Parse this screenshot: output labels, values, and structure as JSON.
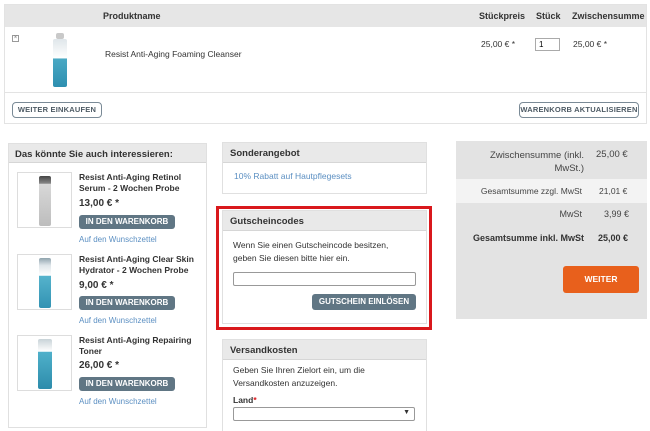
{
  "cart": {
    "headers": {
      "product": "Produktname",
      "unit_price": "Stückpreis",
      "qty": "Stück",
      "subtotal": "Zwischensumme"
    },
    "item": {
      "name": "Resist Anti-Aging Foaming Cleanser",
      "unit_price": "25,00 € *",
      "qty": "1",
      "subtotal": "25,00 € *",
      "remove_icon": "close-icon"
    },
    "continue_label": "WEITER EINKAUFEN",
    "update_label": "WARENKORB AKTUALISIEREN"
  },
  "suggestions": {
    "title": "Das könnte Sie auch interessieren:",
    "items": [
      {
        "name": "Resist Anti-Aging Retinol Serum - 2 Wochen Probe",
        "price": "13,00 € *",
        "cart_label": "IN DEN WARENKORB",
        "wishlist": "Auf den Wunschzettel"
      },
      {
        "name": "Resist Anti-Aging Clear Skin Hydrator - 2 Wochen Probe",
        "price": "9,00 € *",
        "cart_label": "IN DEN WARENKORB",
        "wishlist": "Auf den Wunschzettel"
      },
      {
        "name": "Resist Anti-Aging Repairing Toner",
        "price": "26,00 € *",
        "cart_label": "IN DEN WARENKORB",
        "wishlist": "Auf den Wunschzettel"
      }
    ]
  },
  "special": {
    "title": "Sonderangebot",
    "link": "10% Rabatt auf Hautpflegesets"
  },
  "coupon": {
    "title": "Gutscheincodes",
    "text": "Wenn Sie einen Gutscheincode besitzen, geben Sie diesen bitte hier ein.",
    "input_value": "",
    "button": "GUTSCHEIN EINLÖSEN",
    "highlight_color": "#d9181c"
  },
  "shipping": {
    "title": "Versandkosten",
    "text": "Geben Sie Ihren Zielort ein, um die Versandkosten anzuzeigen.",
    "country_label": "Land",
    "required_mark": "*",
    "country_value": ""
  },
  "totals": {
    "rows": [
      {
        "label": "Zwischensumme (inkl. MwSt.)",
        "value": "25,00 €"
      },
      {
        "label": "Gesamtsumme zzgl. MwSt",
        "value": "21,01 €"
      },
      {
        "label": "MwSt",
        "value": "3,99 €"
      },
      {
        "label": "Gesamtsumme inkl. MwSt",
        "value": "25,00 €"
      }
    ],
    "checkout_label": "WEITER",
    "checkout_color": "#e8601c"
  }
}
